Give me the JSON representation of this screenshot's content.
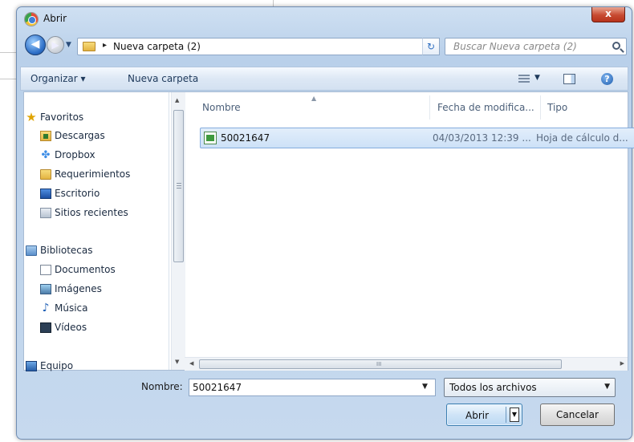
{
  "window": {
    "title": "Abrir",
    "close_label": "x"
  },
  "address": {
    "breadcrumb_separator": "▸",
    "current_folder": "Nueva carpeta (2)",
    "search_placeholder": "Buscar Nueva carpeta (2)"
  },
  "toolbar": {
    "organize_label": "Organizar ▾",
    "new_folder_label": "Nueva carpeta"
  },
  "sidebar": {
    "favorites": {
      "label": "Favoritos",
      "items": [
        {
          "label": "Descargas",
          "icon": "downloads-folder-icon"
        },
        {
          "label": "Dropbox",
          "icon": "dropbox-icon"
        },
        {
          "label": "Requerimientos",
          "icon": "folder-icon"
        },
        {
          "label": "Escritorio",
          "icon": "desktop-icon"
        },
        {
          "label": "Sitios recientes",
          "icon": "recent-places-icon"
        }
      ]
    },
    "libraries": {
      "label": "Bibliotecas",
      "items": [
        {
          "label": "Documentos",
          "icon": "documents-icon"
        },
        {
          "label": "Imágenes",
          "icon": "pictures-icon"
        },
        {
          "label": "Música",
          "icon": "music-icon"
        },
        {
          "label": "Vídeos",
          "icon": "videos-icon"
        }
      ]
    },
    "computer": {
      "label": "Equipo"
    }
  },
  "file_list": {
    "columns": [
      "Nombre",
      "Fecha de modifica...",
      "Tipo"
    ],
    "rows": [
      {
        "name": "50021647",
        "date": "04/03/2013 12:39 ...",
        "type": "Hoja de cálculo d...",
        "selected": true
      }
    ]
  },
  "footer": {
    "name_label": "Nombre:",
    "name_value": "50021647",
    "file_type": "Todos los archivos",
    "open_label": "Abrir",
    "cancel_label": "Cancelar"
  },
  "scrollbar": {
    "grip_glyph": "III"
  },
  "colors": {
    "selection": "#cde1f7",
    "selection_border": "#84acdd",
    "frame": "#b9d0ea"
  }
}
